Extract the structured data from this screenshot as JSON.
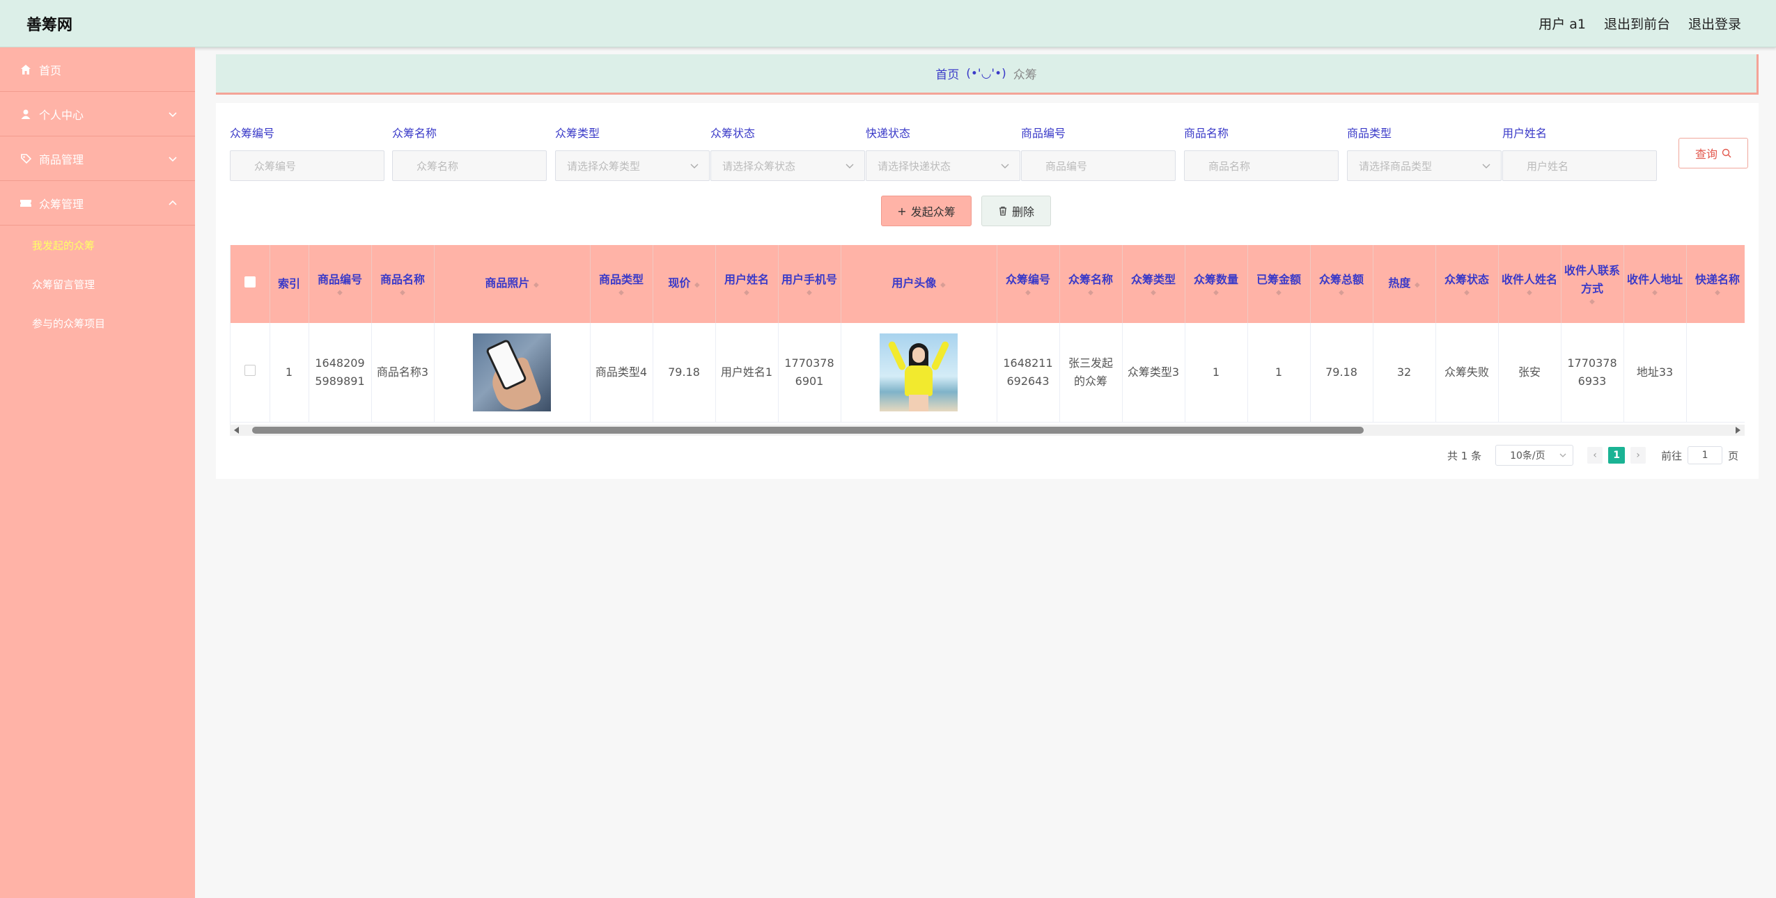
{
  "header": {
    "brand": "善筹网",
    "links": [
      "用户 a1",
      "退出到前台",
      "退出登录"
    ]
  },
  "sidebar": {
    "items": [
      {
        "label": "首页",
        "icon": "home-icon"
      },
      {
        "label": "个人中心",
        "icon": "user-icon"
      },
      {
        "label": "商品管理",
        "icon": "tag-icon"
      },
      {
        "label": "众筹管理",
        "icon": "ticket-icon"
      }
    ],
    "subitems": [
      "我发起的众筹",
      "众筹留言管理",
      "参与的众筹项目"
    ]
  },
  "breadcrumb": {
    "home": "首页",
    "face": "(•'◡'•)",
    "current": "众筹"
  },
  "filters": {
    "labels": [
      "众筹编号",
      "众筹名称",
      "众筹类型",
      "众筹状态",
      "快递状态",
      "商品编号",
      "商品名称",
      "商品类型",
      "用户姓名"
    ],
    "placeholders": [
      "众筹编号",
      "众筹名称",
      "请选择众筹类型",
      "请选择众筹状态",
      "请选择快递状态",
      "商品编号",
      "商品名称",
      "请选择商品类型",
      "用户姓名"
    ],
    "query_label": "查询"
  },
  "actions": {
    "add_label": "发起众筹",
    "delete_label": "删除"
  },
  "table": {
    "columns": [
      "索引",
      "商品编号",
      "商品名称",
      "商品照片",
      "商品类型",
      "现价",
      "用户姓名",
      "用户手机号",
      "用户头像",
      "众筹编号",
      "众筹名称",
      "众筹类型",
      "众筹数量",
      "已筹金额",
      "众筹总额",
      "热度",
      "众筹状态",
      "收件人姓名",
      "收件人联系方式",
      "收件人地址",
      "快递名称"
    ],
    "row": {
      "index": "1",
      "product_no": "16482095989891",
      "product_name": "商品名称3",
      "product_type": "商品类型4",
      "price": "79.18",
      "user_name": "用户姓名1",
      "user_phone": "17703786901",
      "crowd_no": "1648211692643",
      "crowd_name": "张三发起的众筹",
      "crowd_type": "众筹类型3",
      "crowd_qty": "1",
      "raised": "1",
      "total": "79.18",
      "heat": "32",
      "status": "众筹失败",
      "recipient": "张安",
      "recipient_phone": "17703786933",
      "address": "地址33",
      "courier": ""
    }
  },
  "pagination": {
    "total": "共 1 条",
    "page_size": "10条/页",
    "current": "1",
    "goto_label": "前往",
    "goto_value": "1",
    "page_suffix": "页"
  },
  "colors": {
    "sidebar": "#ffb3a7",
    "header": "#dcefe8",
    "accent_text": "#3a3ac8",
    "active_sub": "#ffff66",
    "page_active": "#1ab394"
  }
}
